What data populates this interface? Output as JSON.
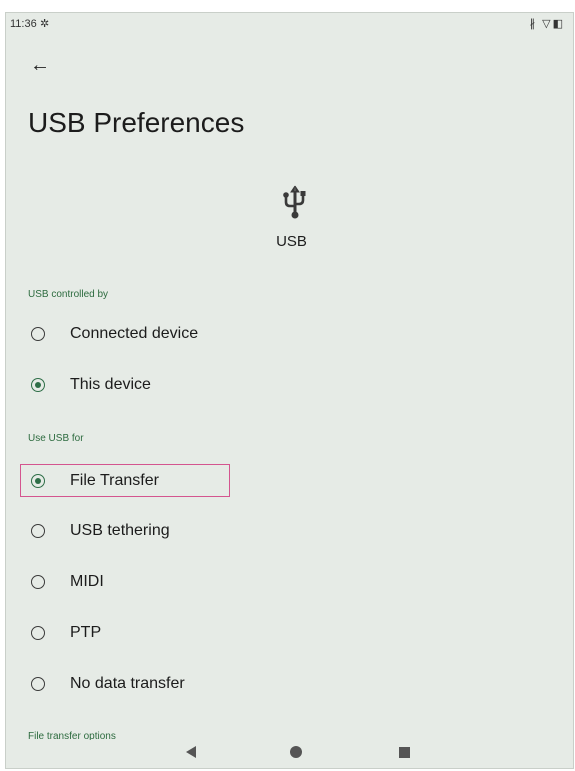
{
  "status_bar": {
    "time": "11:36",
    "settings_glyph": "✲",
    "right_icons": "∦ ▽◧"
  },
  "page": {
    "title": "USB Preferences",
    "device_label": "USB",
    "back_icon": "←"
  },
  "sections": {
    "controlled_by": {
      "header": "USB controlled by",
      "options": [
        {
          "label": "Connected device",
          "selected": false
        },
        {
          "label": "This device",
          "selected": true
        }
      ]
    },
    "use_for": {
      "header": "Use USB for",
      "options": [
        {
          "label": "File Transfer",
          "selected": true
        },
        {
          "label": "USB tethering",
          "selected": false
        },
        {
          "label": "MIDI",
          "selected": false
        },
        {
          "label": "PTP",
          "selected": false
        },
        {
          "label": "No data transfer",
          "selected": false
        }
      ]
    },
    "file_transfer_options": {
      "header": "File transfer options"
    }
  },
  "colors": {
    "accent": "#2e6e47",
    "background": "#e6ebe6",
    "highlight": "#d4558f"
  }
}
